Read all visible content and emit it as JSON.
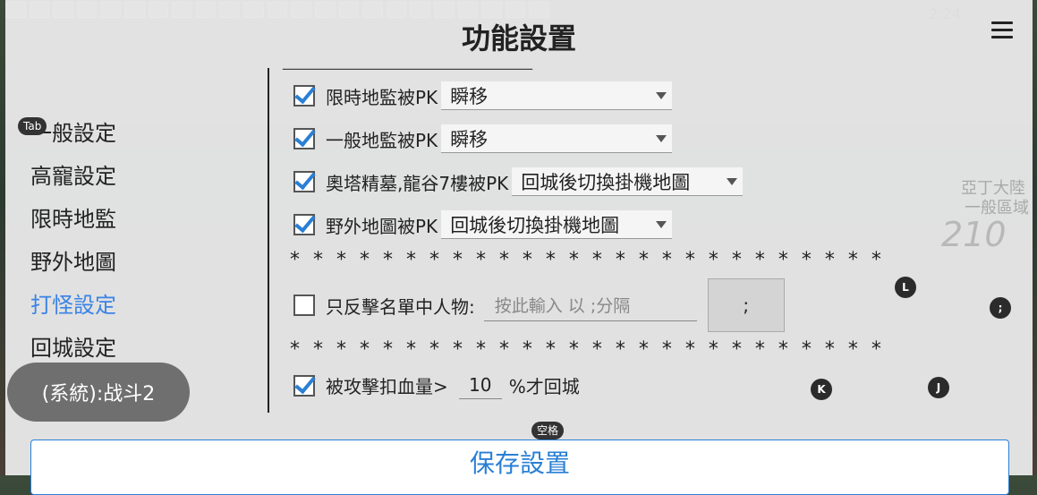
{
  "title": "功能設置",
  "clock": "2:24",
  "background_labels": {
    "area_name": "亞丁大陸",
    "area_sub": "一般區域",
    "kill_count": "210"
  },
  "sidebar": {
    "items": [
      {
        "label": "一般設定",
        "active": false
      },
      {
        "label": "高寵設定",
        "active": false
      },
      {
        "label": "限時地監",
        "active": false
      },
      {
        "label": "野外地圖",
        "active": false
      },
      {
        "label": "打怪設定",
        "active": true
      },
      {
        "label": "回城設定",
        "active": false
      }
    ]
  },
  "dash_line": "_______________________________",
  "options": [
    {
      "label": "限時地監被PK",
      "checked": true,
      "value": "瞬移"
    },
    {
      "label": "一般地監被PK",
      "checked": true,
      "value": "瞬移"
    },
    {
      "label": "奧塔精墓,龍谷7樓被PK",
      "checked": true,
      "value": "回城後切換掛機地圖"
    },
    {
      "label": "野外地圖被PK",
      "checked": true,
      "value": "回城後切換掛機地圖"
    }
  ],
  "stars": "* * * * * * * * * * * * * * * * * * * * * * * * * *",
  "counter_attack": {
    "label": "只反擊名單中人物:",
    "checked": false,
    "placeholder": "按此輸入 以 ;分隔",
    "separator_button": ";"
  },
  "hp_return": {
    "label_prefix": "被攻擊扣血量>",
    "value": "10",
    "label_suffix": "%才回城",
    "checked": true
  },
  "save_button": "保存設置",
  "key_hints": {
    "tab": "Tab",
    "space": "空格",
    "l": "L",
    "semicolon": ";",
    "k": "K",
    "j": "J"
  },
  "toast": "(系統):战斗2"
}
